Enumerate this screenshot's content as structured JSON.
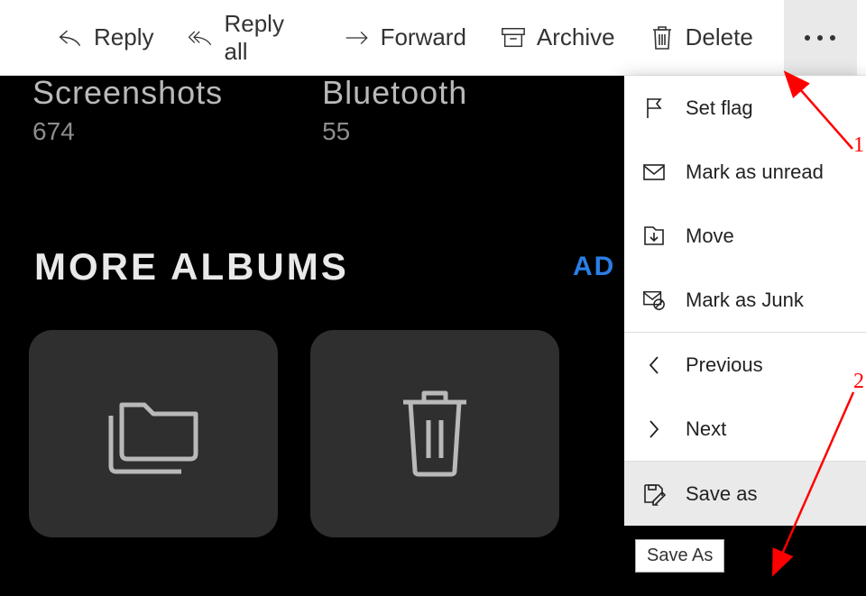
{
  "toolbar": {
    "reply": "Reply",
    "reply_all": "Reply all",
    "forward": "Forward",
    "archive": "Archive",
    "delete": "Delete"
  },
  "dropdown": {
    "set_flag": "Set flag",
    "mark_unread": "Mark as unread",
    "move": "Move",
    "mark_junk": "Mark as Junk",
    "previous": "Previous",
    "next": "Next",
    "save_as": "Save as"
  },
  "tooltip": {
    "save_as": "Save As"
  },
  "content": {
    "album1": {
      "title": "Screenshots",
      "count": "674"
    },
    "album2": {
      "title": "Bluetooth",
      "count": "55"
    },
    "section": "MORE ALBUMS",
    "add": "AD"
  },
  "annotations": {
    "one": "1",
    "two": "2"
  }
}
